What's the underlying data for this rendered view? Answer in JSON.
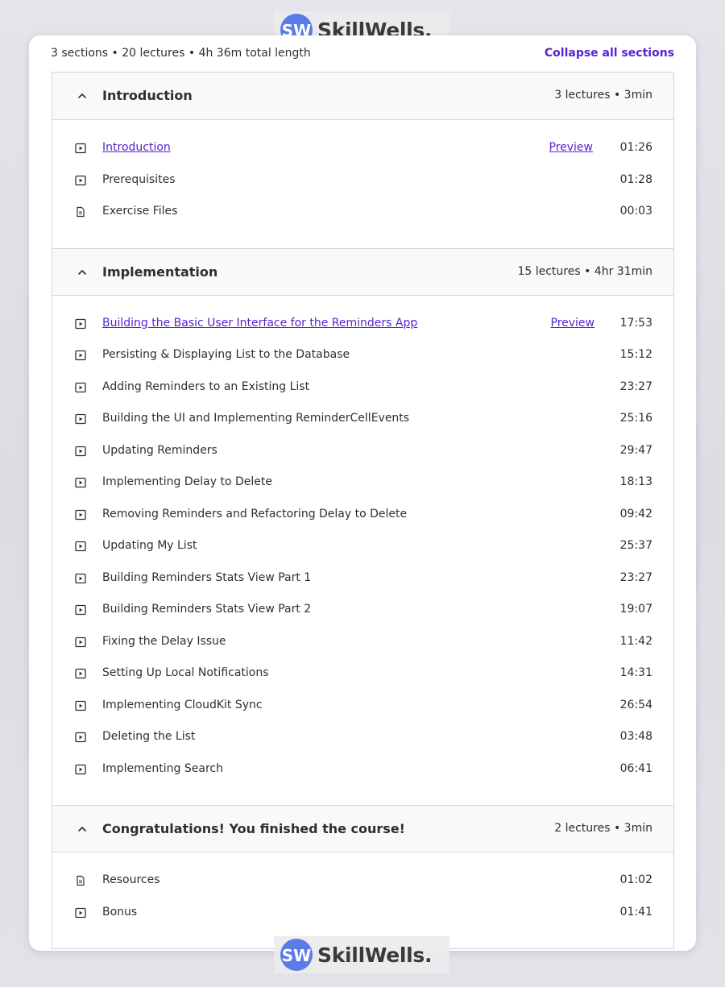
{
  "summary": "3 sections • 20 lectures • 4h 36m total length",
  "collapse_all_label": "Collapse all sections",
  "watermark": {
    "text": "SkillWells.",
    "logo_letters": "SW"
  },
  "colors": {
    "accent": "#5624d0",
    "header_bg": "#f7f9fa",
    "border": "#d1d7dc",
    "text": "#2d2f31"
  },
  "sections": [
    {
      "title": "Introduction",
      "meta": "3 lectures • 3min",
      "lectures": [
        {
          "title": "Introduction",
          "icon": "video-icon",
          "preview": "Preview",
          "duration": "01:26"
        },
        {
          "title": "Prerequisites",
          "icon": "video-icon",
          "duration": "01:28"
        },
        {
          "title": "Exercise Files",
          "icon": "file-icon",
          "duration": "00:03"
        }
      ]
    },
    {
      "title": "Implementation",
      "meta": "15 lectures • 4hr 31min",
      "lectures": [
        {
          "title": "Building the Basic User Interface for the Reminders App",
          "icon": "video-icon",
          "preview": "Preview",
          "duration": "17:53"
        },
        {
          "title": "Persisting & Displaying List to the Database",
          "icon": "video-icon",
          "duration": "15:12"
        },
        {
          "title": "Adding Reminders to an Existing List",
          "icon": "video-icon",
          "duration": "23:27"
        },
        {
          "title": "Building the UI and Implementing ReminderCellEvents",
          "icon": "video-icon",
          "duration": "25:16"
        },
        {
          "title": "Updating Reminders",
          "icon": "video-icon",
          "duration": "29:47"
        },
        {
          "title": "Implementing Delay to Delete",
          "icon": "video-icon",
          "duration": "18:13"
        },
        {
          "title": "Removing Reminders and Refactoring Delay to Delete",
          "icon": "video-icon",
          "duration": "09:42"
        },
        {
          "title": "Updating My List",
          "icon": "video-icon",
          "duration": "25:37"
        },
        {
          "title": "Building Reminders Stats View Part 1",
          "icon": "video-icon",
          "duration": "23:27"
        },
        {
          "title": "Building Reminders Stats View Part 2",
          "icon": "video-icon",
          "duration": "19:07"
        },
        {
          "title": "Fixing the Delay Issue",
          "icon": "video-icon",
          "duration": "11:42"
        },
        {
          "title": "Setting Up Local Notifications",
          "icon": "video-icon",
          "duration": "14:31"
        },
        {
          "title": "Implementing CloudKit Sync",
          "icon": "video-icon",
          "duration": "26:54"
        },
        {
          "title": "Deleting the List",
          "icon": "video-icon",
          "duration": "03:48"
        },
        {
          "title": "Implementing Search",
          "icon": "video-icon",
          "duration": "06:41"
        }
      ]
    },
    {
      "title": "Congratulations! You finished the course!",
      "meta": "2 lectures • 3min",
      "lectures": [
        {
          "title": "Resources",
          "icon": "file-icon",
          "duration": "01:02"
        },
        {
          "title": "Bonus",
          "icon": "video-icon",
          "duration": "01:41"
        }
      ]
    }
  ]
}
